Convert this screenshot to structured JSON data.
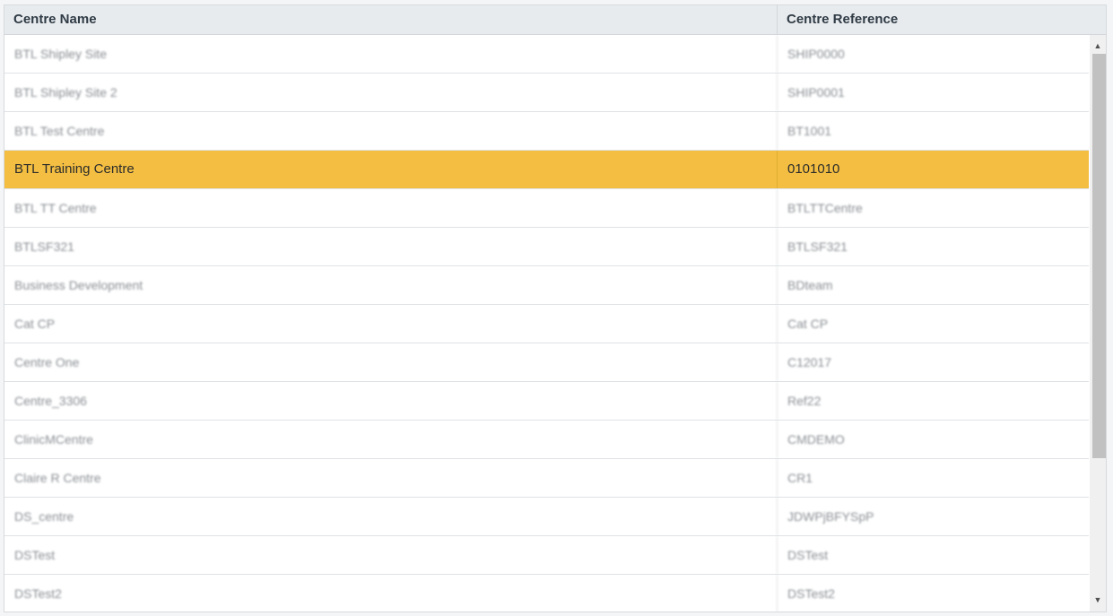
{
  "columns": {
    "name": "Centre Name",
    "reference": "Centre Reference"
  },
  "rows": [
    {
      "name": "BTL Shipley Site",
      "reference": "SHIP0000"
    },
    {
      "name": "BTL Shipley Site 2",
      "reference": "SHIP0001"
    },
    {
      "name": "BTL Test Centre",
      "reference": "BT1001"
    },
    {
      "name": "BTL Training Centre",
      "reference": "0101010",
      "selected": true
    },
    {
      "name": "BTL TT Centre",
      "reference": "BTLTTCentre"
    },
    {
      "name": "BTLSF321",
      "reference": "BTLSF321"
    },
    {
      "name": "Business Development",
      "reference": "BDteam"
    },
    {
      "name": "Cat CP",
      "reference": "Cat CP"
    },
    {
      "name": "Centre One",
      "reference": "C12017"
    },
    {
      "name": "Centre_3306",
      "reference": "Ref22"
    },
    {
      "name": "ClinicMCentre",
      "reference": "CMDEMO"
    },
    {
      "name": "Claire R Centre",
      "reference": "CR1"
    },
    {
      "name": "DS_centre",
      "reference": "JDWPjBFYSpP"
    },
    {
      "name": "DSTest",
      "reference": "DSTest"
    },
    {
      "name": "DSTest2",
      "reference": "DSTest2"
    }
  ],
  "icons": {
    "scroll_up": "triangle-up",
    "scroll_down": "triangle-down"
  },
  "colors": {
    "header_bg": "#e8ebee",
    "selected_row": "#f3be41",
    "scrollbar_thumb": "#c1c1c1"
  }
}
